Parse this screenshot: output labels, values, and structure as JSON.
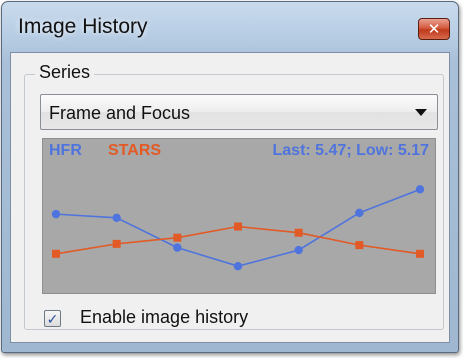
{
  "window": {
    "title": "Image History",
    "close_glyph": "✕"
  },
  "series_group": {
    "label": "Series",
    "selected": "Frame and Focus"
  },
  "chart": {
    "legend_hfr": "HFR",
    "legend_stars": "STARS",
    "stats": "Last: 5.47; Low: 5.17"
  },
  "chart_data": {
    "type": "line",
    "title": "",
    "xlabel": "",
    "ylabel": "",
    "grid": false,
    "legend_placement": "top-left",
    "x": [
      1,
      2,
      3,
      4,
      5,
      6,
      7
    ],
    "ylim": [
      0,
      1
    ],
    "series": [
      {
        "name": "HFR",
        "color": "#4f74dd",
        "marker": "circle",
        "values": [
          0.62,
          0.59,
          0.35,
          0.2,
          0.33,
          0.63,
          0.82
        ]
      },
      {
        "name": "STARS",
        "color": "#e25a25",
        "marker": "square",
        "values": [
          0.3,
          0.38,
          0.43,
          0.52,
          0.47,
          0.37,
          0.3
        ]
      }
    ]
  },
  "options": {
    "enable_label": "Enable image history",
    "enable_checked": true,
    "check_glyph": "✓"
  },
  "colors": {
    "hfr": "#4f74dd",
    "stars": "#e25a25",
    "chart_bg": "#a8a8a8"
  }
}
